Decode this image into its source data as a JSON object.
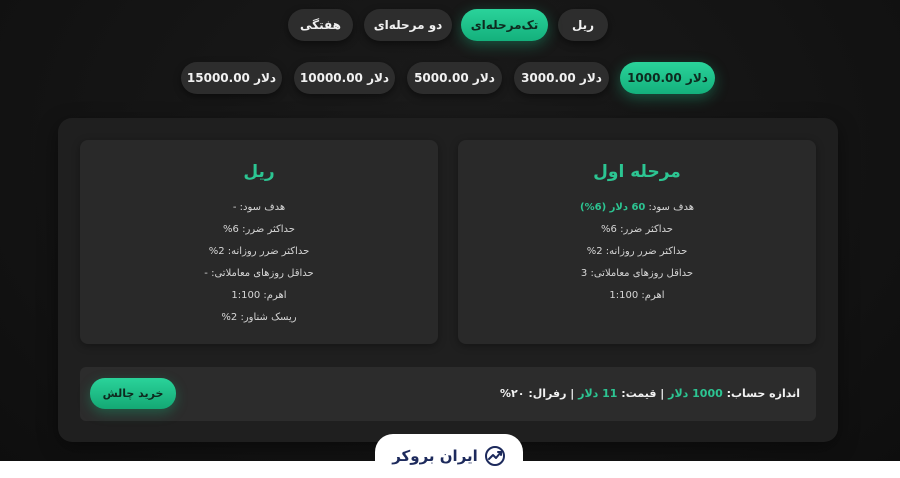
{
  "tabs": [
    {
      "label": "ریل",
      "active": false
    },
    {
      "label": "تک‌مرحله‌ای",
      "active": true
    },
    {
      "label": "دو مرحله‌ای",
      "active": false
    },
    {
      "label": "هفتگی",
      "active": false
    }
  ],
  "amounts": [
    {
      "label": "1000.00 دلار",
      "active": true
    },
    {
      "label": "3000.00 دلار",
      "active": false
    },
    {
      "label": "5000.00 دلار",
      "active": false
    },
    {
      "label": "10000.00 دلار",
      "active": false
    },
    {
      "label": "15000.00 دلار",
      "active": false
    }
  ],
  "phase_card": {
    "title": "مرحله اول",
    "profit_target_label": "هدف سود:",
    "profit_target_value": "60 دلار (6%)",
    "max_loss": "حداکثر ضرر: 6%",
    "max_daily_loss": "حداکثر ضرر روزانه: 2%",
    "min_trading_days": "حداقل روزهای معاملاتی: 3",
    "leverage": "اهرم: 1:100"
  },
  "real_card": {
    "title": "ریل",
    "profit_target": "هدف سود: -",
    "max_loss": "حداکثر ضرر: 6%",
    "max_daily_loss": "حداکثر ضرر روزانه: 2%",
    "min_trading_days": "حداقل روزهای معاملاتی: -",
    "leverage": "اهرم: 1:100",
    "floating_risk": "ریسک شناور: 2%"
  },
  "summary": {
    "account_size_label": "اندازه حساب:",
    "account_size_value": "1000 دلار",
    "price_label": "قیمت:",
    "price_value": "11 دلار",
    "refund_label": "رفرال:",
    "refund_value": "۲۰%",
    "separator": "|"
  },
  "buy_button": {
    "label": "خرید چالش"
  },
  "brand": {
    "name": "ایران بروکر",
    "icon": "trend-chart-icon"
  },
  "colors": {
    "accent": "#2cc592",
    "background": "#121212",
    "card": "#292929"
  }
}
